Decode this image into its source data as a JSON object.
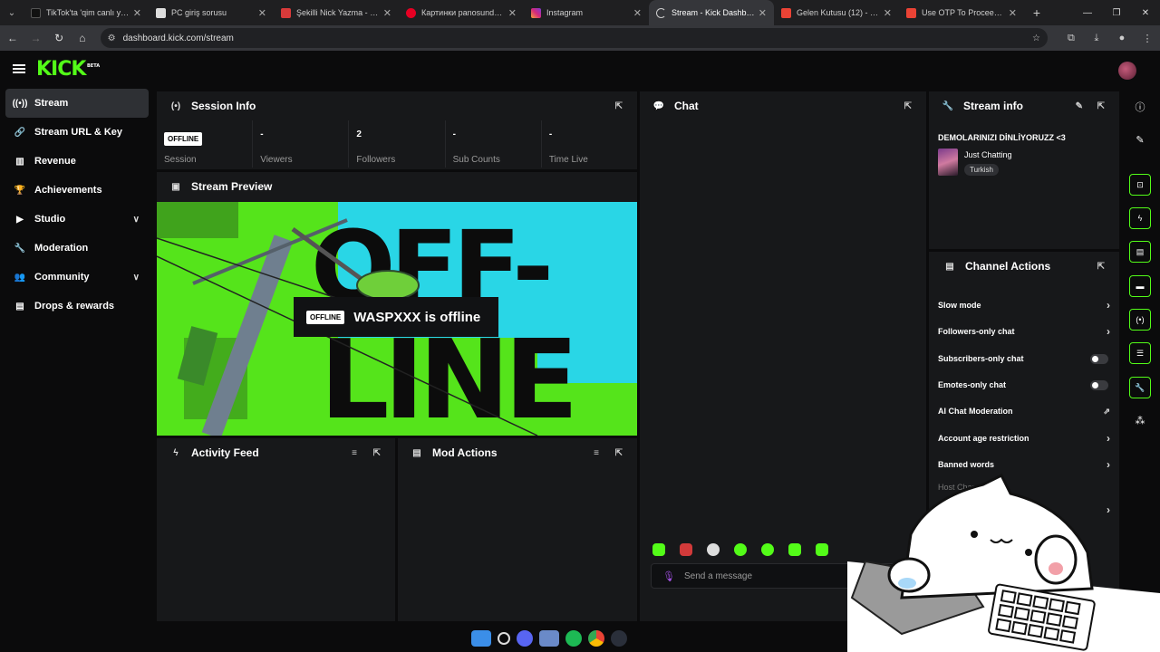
{
  "browser": {
    "tabs": [
      {
        "title": "TikTok'ta 'qim canlı yayın",
        "color": "#111111"
      },
      {
        "title": "PC giriş sorusu",
        "color": "#e0e0e0"
      },
      {
        "title": "Şekilli Nick Yazma - Şekilli",
        "color": "#d83a3a"
      },
      {
        "title": "Картинки panosundaki Pi",
        "color": "#e60023"
      },
      {
        "title": "Instagram",
        "color": "#d6297a"
      },
      {
        "title": "Stream - Kick Dashboard",
        "color": "#53fc18"
      },
      {
        "title": "Gelen Kutusu (12) - wasp",
        "color": "#ea4335"
      },
      {
        "title": "Use OTP To Proceed - wa",
        "color": "#ea4335"
      }
    ],
    "url": "dashboard.kick.com/stream"
  },
  "header": {
    "logo": "KICK",
    "logo_badge": "BETA"
  },
  "sidebar": {
    "items": [
      {
        "label": "Stream",
        "icon": "broadcast-icon"
      },
      {
        "label": "Stream URL & Key",
        "icon": "link-icon"
      },
      {
        "label": "Revenue",
        "icon": "chart-icon"
      },
      {
        "label": "Achievements",
        "icon": "trophy-icon"
      },
      {
        "label": "Studio",
        "icon": "video-icon"
      },
      {
        "label": "Moderation",
        "icon": "wrench-icon"
      },
      {
        "label": "Community",
        "icon": "users-icon"
      },
      {
        "label": "Drops & rewards",
        "icon": "gift-icon"
      }
    ]
  },
  "session": {
    "title": "Session Info",
    "badge": "OFFLINE",
    "stats": [
      {
        "label": "Session",
        "value": ""
      },
      {
        "label": "Viewers",
        "value": "-"
      },
      {
        "label": "Followers",
        "value": "2"
      },
      {
        "label": "Sub Counts",
        "value": "-"
      },
      {
        "label": "Time Live",
        "value": "-"
      }
    ]
  },
  "preview": {
    "title": "Stream Preview",
    "badge": "OFFLINE",
    "status": "WASPXXX is offline",
    "bg_word_1": "OFF-",
    "bg_word_2": "LINE"
  },
  "activity": {
    "title": "Activity Feed"
  },
  "mod_actions": {
    "title": "Mod Actions"
  },
  "chat": {
    "title": "Chat",
    "placeholder": "Send a message"
  },
  "stream_info": {
    "title": "Stream info",
    "stream_title": "DEMOLARINIZI DİNLİYORUZZ <3",
    "category": "Just Chatting",
    "tag": "Turkish"
  },
  "channel_actions": {
    "title": "Channel Actions",
    "items": [
      {
        "label": "Slow mode",
        "control": "arrow"
      },
      {
        "label": "Followers-only chat",
        "control": "arrow"
      },
      {
        "label": "Subscribers-only chat",
        "control": "toggle"
      },
      {
        "label": "Emotes-only chat",
        "control": "toggle"
      },
      {
        "label": "AI Chat Moderation",
        "control": "external"
      },
      {
        "label": "Account age restriction",
        "control": "arrow"
      },
      {
        "label": "Banned words",
        "control": "arrow"
      },
      {
        "label": "Host Chann",
        "control": "none"
      },
      {
        "label": "Se",
        "control": "arrow"
      }
    ]
  },
  "colors": {
    "accent": "#53fc18",
    "panel": "#17181a",
    "background": "#0b0b0c"
  }
}
